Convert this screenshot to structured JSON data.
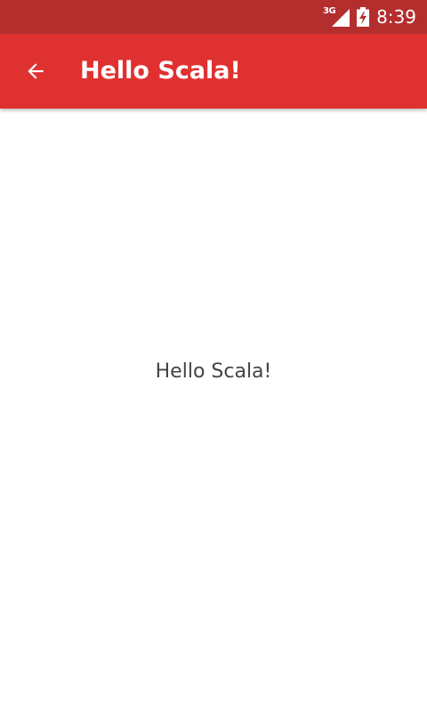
{
  "status_bar": {
    "network_label": "3G",
    "time": "8:39",
    "signal_icon": "signal-icon",
    "battery_icon": "battery-charging-icon",
    "color": "#b42e2e"
  },
  "app_bar": {
    "title": "Hello Scala!",
    "back_icon": "arrow-back-icon",
    "color": "#e03131"
  },
  "content": {
    "message": "Hello Scala!"
  }
}
